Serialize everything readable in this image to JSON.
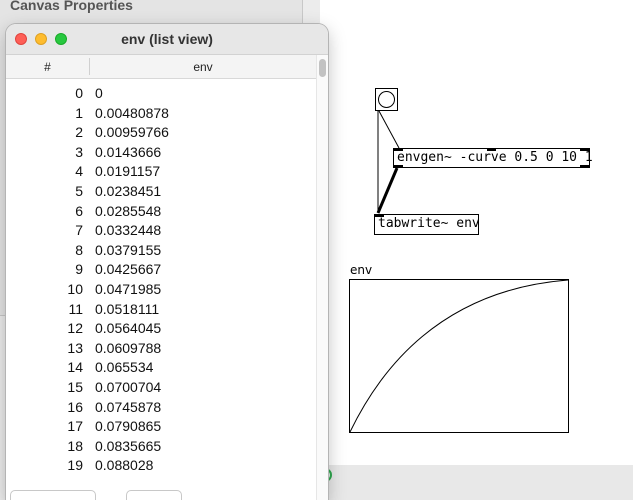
{
  "background_window": {
    "title": "Canvas Properties"
  },
  "list_view": {
    "title": "env (list view)",
    "columns": {
      "index": "#",
      "value": "env"
    },
    "rows": [
      {
        "i": "0",
        "v": "0"
      },
      {
        "i": "1",
        "v": "0.00480878"
      },
      {
        "i": "2",
        "v": "0.00959766"
      },
      {
        "i": "3",
        "v": "0.0143666"
      },
      {
        "i": "4",
        "v": "0.0191157"
      },
      {
        "i": "5",
        "v": "0.0238451"
      },
      {
        "i": "6",
        "v": "0.0285548"
      },
      {
        "i": "7",
        "v": "0.0332448"
      },
      {
        "i": "8",
        "v": "0.0379155"
      },
      {
        "i": "9",
        "v": "0.0425667"
      },
      {
        "i": "10",
        "v": "0.0471985"
      },
      {
        "i": "11",
        "v": "0.0518111"
      },
      {
        "i": "12",
        "v": "0.0564045"
      },
      {
        "i": "13",
        "v": "0.0609788"
      },
      {
        "i": "14",
        "v": "0.065534"
      },
      {
        "i": "15",
        "v": "0.0700704"
      },
      {
        "i": "16",
        "v": "0.0745878"
      },
      {
        "i": "17",
        "v": "0.0790865"
      },
      {
        "i": "18",
        "v": "0.0835665"
      },
      {
        "i": "19",
        "v": "0.088028"
      }
    ]
  },
  "patch": {
    "bang_icon": "bang-circle",
    "envgen_object": "envgen~ -curve 0.5 0 10 1",
    "tabwrite_object": "tabwrite~ env",
    "array_name": "env"
  }
}
